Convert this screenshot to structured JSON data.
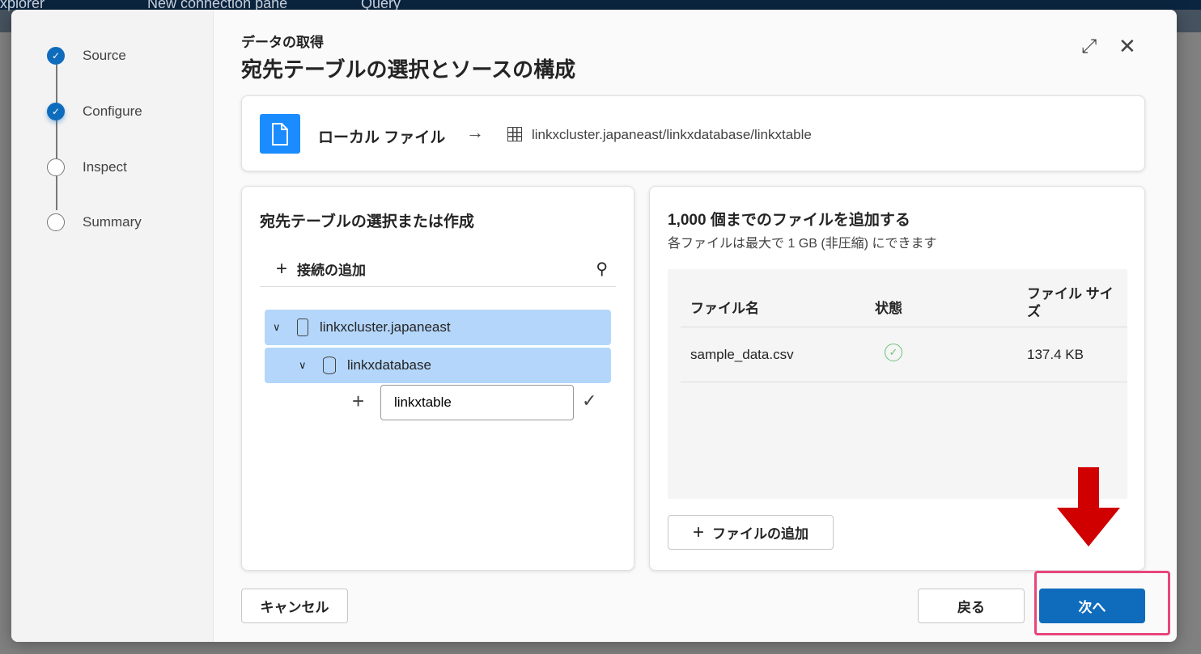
{
  "background": {
    "app_title": "xplorer",
    "toggle_label": "New connection pane",
    "query_label": "Query"
  },
  "steps": [
    {
      "label": "Source",
      "state": "done"
    },
    {
      "label": "Configure",
      "state": "done"
    },
    {
      "label": "Inspect",
      "state": "pending"
    },
    {
      "label": "Summary",
      "state": "pending"
    }
  ],
  "header": {
    "subtitle": "データの取得",
    "title": "宛先テーブルの選択とソースの構成"
  },
  "source": {
    "label": "ローカル ファイル",
    "destination": "linkxcluster.japaneast/linkxdatabase/linkxtable"
  },
  "left_panel": {
    "title": "宛先テーブルの選択または作成",
    "add_connection": "接続の追加",
    "cluster": "linkxcluster.japaneast",
    "database": "linkxdatabase",
    "table_input_value": "linkxtable"
  },
  "right_panel": {
    "title": "1,000 個までのファイルを追加する",
    "subtitle": "各ファイルは最大で 1 GB (非圧縮) にできます",
    "columns": [
      "ファイル名",
      "状態",
      "ファイル サイズ"
    ],
    "rows": [
      {
        "name": "sample_data.csv",
        "status": "success",
        "size": "137.4 KB"
      }
    ],
    "add_file": "ファイルの追加"
  },
  "footer": {
    "cancel": "キャンセル",
    "back": "戻る",
    "next": "次へ"
  },
  "colors": {
    "accent": "#0f6cbd",
    "selected_row": "#b4d6fa",
    "annotation": "#d00000",
    "highlight_box": "#e8457a"
  }
}
